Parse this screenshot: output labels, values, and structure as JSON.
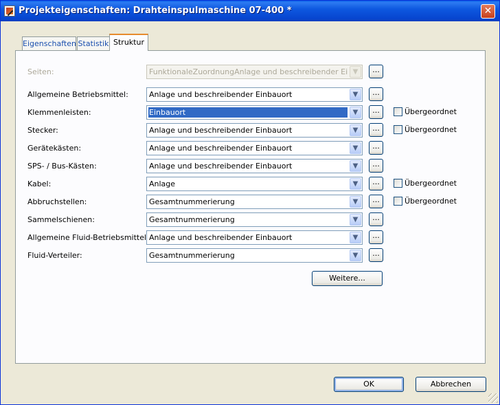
{
  "window": {
    "title": "Projekteigenschaften: Drahteinspulmaschine 07-400 *",
    "close_label": "✕"
  },
  "tabs": [
    {
      "label": "Eigenschaften"
    },
    {
      "label": "Statistik"
    },
    {
      "label": "Struktur"
    }
  ],
  "active_tab": "Struktur",
  "rows": [
    {
      "label": "Seiten:",
      "value": "FunktionaleZuordnungAnlage und beschreibender Einbauort"
    },
    {
      "label": "Allgemeine Betriebsmittel:",
      "value": "Anlage und beschreibender Einbauort"
    },
    {
      "label": "Klemmenleisten:",
      "value": "Einbauort",
      "checkbox": "Übergeordnet"
    },
    {
      "label": "Stecker:",
      "value": "Anlage und beschreibender Einbauort",
      "checkbox": "Übergeordnet"
    },
    {
      "label": "Gerätekästen:",
      "value": "Anlage und beschreibender Einbauort"
    },
    {
      "label": "SPS- / Bus-Kästen:",
      "value": "Anlage und beschreibender Einbauort"
    },
    {
      "label": "Kabel:",
      "value": "Anlage",
      "checkbox": "Übergeordnet"
    },
    {
      "label": "Abbruchstellen:",
      "value": "Gesamtnummerierung",
      "checkbox": "Übergeordnet"
    },
    {
      "label": "Sammelschienen:",
      "value": "Gesamtnummerierung"
    },
    {
      "label": "Allgemeine Fluid-Betriebsmittel:",
      "value": "Anlage und beschreibender Einbauort"
    },
    {
      "label": "Fluid-Verteiler:",
      "value": "Gesamtnummerierung"
    }
  ],
  "dots_label": "...",
  "dropdown_arrow": "▼",
  "buttons": {
    "more": "Weitere...",
    "ok": "OK",
    "cancel": "Abbrechen"
  }
}
